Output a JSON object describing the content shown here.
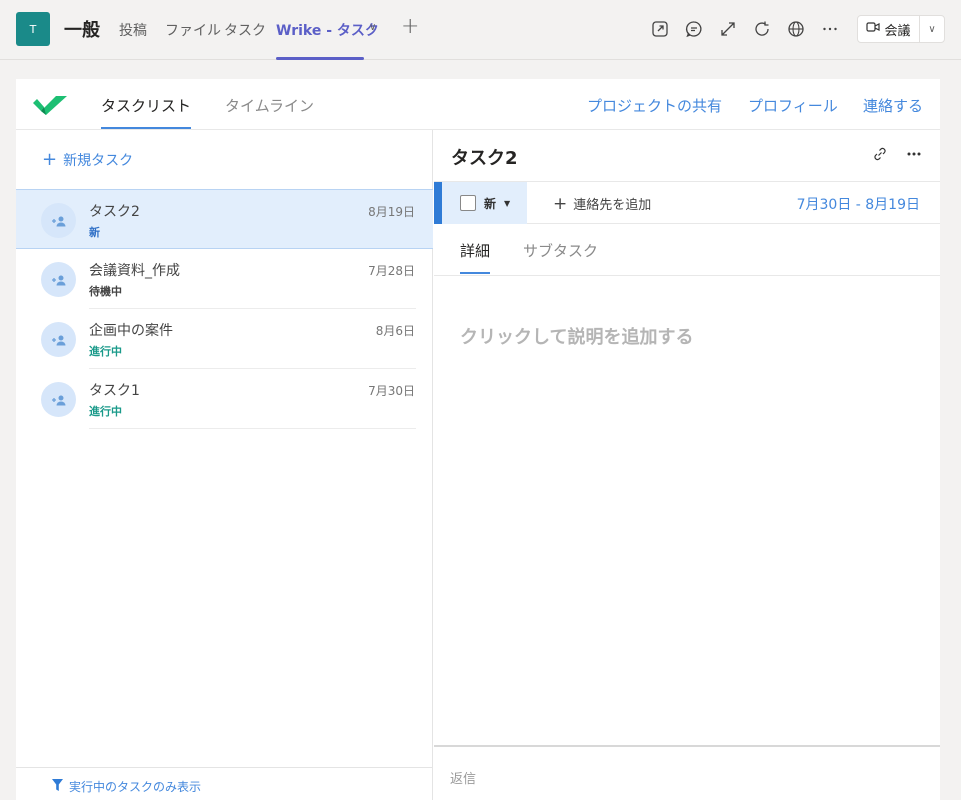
{
  "header": {
    "avatar_letter": "T",
    "channel_title": "一般",
    "tabs": [
      {
        "label": "投稿"
      },
      {
        "label": "ファイル"
      },
      {
        "label": "タスク"
      },
      {
        "label": "Wrike - タスク"
      }
    ],
    "meet_label": "会議"
  },
  "app": {
    "tabs": [
      {
        "label": "タスクリスト"
      },
      {
        "label": "タイムライン"
      }
    ],
    "links": [
      {
        "label": "プロジェクトの共有"
      },
      {
        "label": "プロフィール"
      },
      {
        "label": "連絡する"
      }
    ]
  },
  "list": {
    "new_task_label": "新規タスク",
    "tasks": [
      {
        "title": "タスク2",
        "date": "8月19日",
        "status": "新",
        "status_color": "#2f6fc6"
      },
      {
        "title": "会議資料_作成",
        "date": "7月28日",
        "status": "待機中",
        "status_color": "#444444"
      },
      {
        "title": "企画中の案件",
        "date": "8月6日",
        "status": "進行中",
        "status_color": "#1a9a8a"
      },
      {
        "title": "タスク1",
        "date": "7月30日",
        "status": "進行中",
        "status_color": "#1a9a8a"
      }
    ],
    "filter_label": "実行中のタスクのみ表示"
  },
  "detail": {
    "title": "タスク2",
    "status": "新",
    "add_contact_label": "連絡先を追加",
    "date_range": "7月30日 - 8月19日",
    "tabs": [
      {
        "label": "詳細"
      },
      {
        "label": "サブタスク"
      }
    ],
    "description_placeholder": "クリックして説明を追加する",
    "reply_placeholder": "返信"
  },
  "colors": {
    "teams_accent": "#5b5fc7",
    "wrike_blue": "#4488dd",
    "wrike_green": "#1dbf73",
    "avatar_teal": "#1a8a89"
  }
}
